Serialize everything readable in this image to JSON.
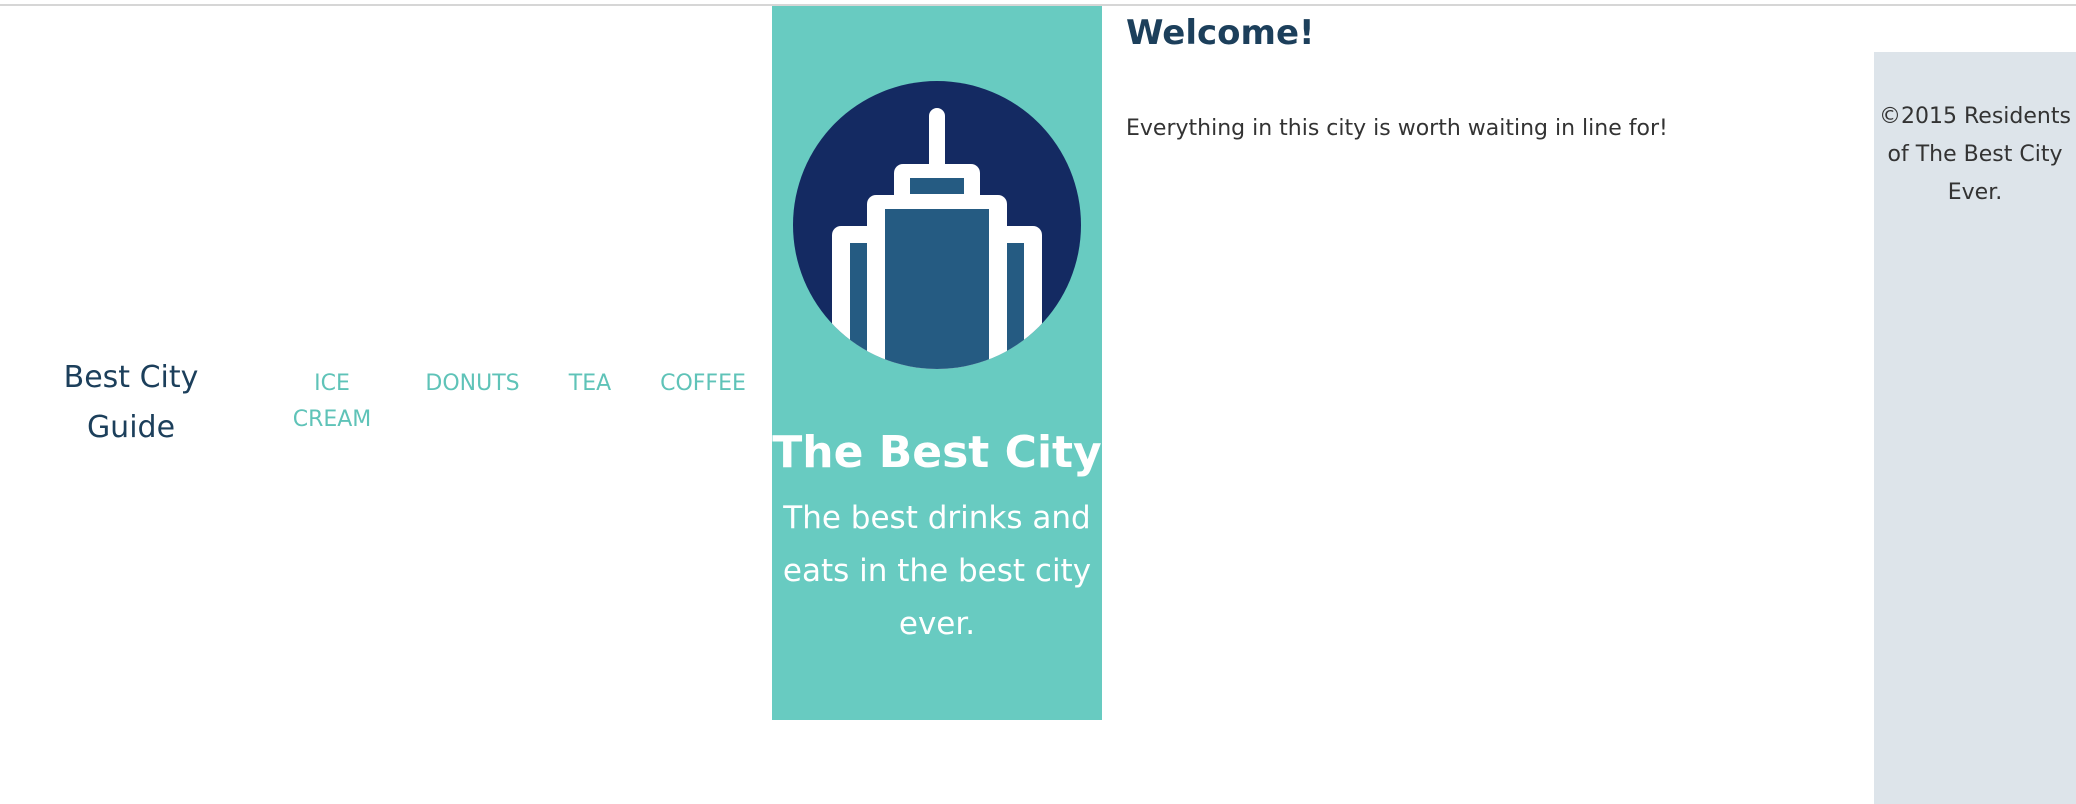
{
  "brand": {
    "title": "Best City Guide"
  },
  "nav": {
    "items": [
      {
        "label": "ICE CREAM"
      },
      {
        "label": "DONUTS"
      },
      {
        "label": "TEA"
      },
      {
        "label": "COFFEE"
      }
    ]
  },
  "hero": {
    "logo_icon": "skyscraper-icon",
    "title": "The Best City",
    "subtitle": "The best drinks and eats in the best city ever."
  },
  "main": {
    "heading": "Welcome!",
    "text": "Everything in this city is worth waiting in line for!"
  },
  "footer": {
    "text": "©2015 Residents of The Best City Ever."
  },
  "colors": {
    "accent_teal": "#68cbc1",
    "nav_link": "#5fc3b8",
    "navy": "#1c3f5b",
    "logo_circle": "#142a62",
    "building": "#255b82",
    "footer_bg": "#dde4ea"
  }
}
